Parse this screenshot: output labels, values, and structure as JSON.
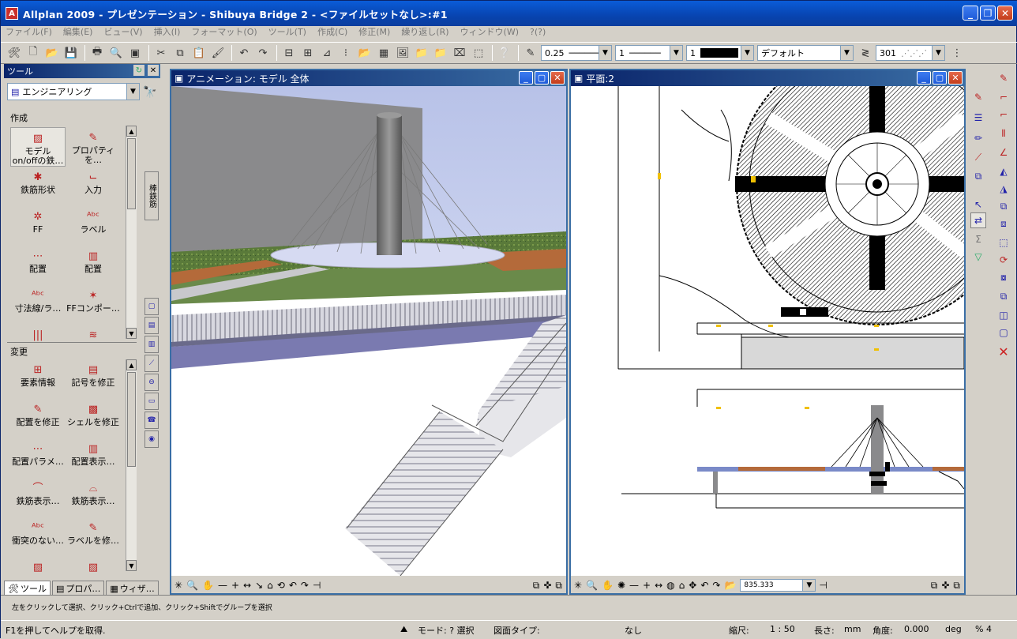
{
  "window": {
    "title": "Allplan 2009 - プレゼンテーション - Shibuya Bridge 2 - <ファイルセットなし>:#1",
    "app_icon": "allplan-icon"
  },
  "menu": [
    "ファイル(F)",
    "編集(E)",
    "ビュー(V)",
    "挿入(I)",
    "フォーマット(O)",
    "ツール(T)",
    "作成(C)",
    "修正(M)",
    "繰り返し(R)",
    "ウィンドウ(W)",
    "?(?)"
  ],
  "toolbar": {
    "pen_thickness": "0.25",
    "line_type": "1",
    "color": "1",
    "layer": "デフォルト",
    "hatch": "301"
  },
  "palette": {
    "title": "ツール",
    "module": "エンジニアリング",
    "side_tab_label": "棒鉄筋",
    "section_create": "作成",
    "section_modify": "変更",
    "create_items": [
      {
        "label": "モデル on/offの鉄…"
      },
      {
        "label": "プロパティを…"
      },
      {
        "label": "鉄筋形状"
      },
      {
        "label": "入力"
      },
      {
        "label": "FF"
      },
      {
        "label": "ラベル"
      },
      {
        "label": "配置"
      },
      {
        "label": "配置"
      },
      {
        "label": "寸法線/ラ…"
      },
      {
        "label": "FFコンポー…"
      },
      {
        "label": ""
      },
      {
        "label": ""
      }
    ],
    "modify_items": [
      {
        "label": "要素情報"
      },
      {
        "label": "記号を修正"
      },
      {
        "label": "配置を修正"
      },
      {
        "label": "シェルを修正"
      },
      {
        "label": "配置パラメ…"
      },
      {
        "label": "配置表示…"
      },
      {
        "label": "鉄筋表示…"
      },
      {
        "label": "鉄筋表示…"
      },
      {
        "label": "衝突のない…"
      },
      {
        "label": "ラベルを修…"
      },
      {
        "label": ""
      },
      {
        "label": ""
      }
    ],
    "tabs": [
      "ツール",
      "プロパ…",
      "ウィザ…"
    ]
  },
  "view_animation": {
    "title": "アニメーション: モデル 全体"
  },
  "view_plan": {
    "title": "平面:2",
    "zoom_value": "835.333"
  },
  "hint": "左をクリックして選択、クリック+Ctrlで追加、クリック+Shiftでグループを選択",
  "status": {
    "help": "F1を押してヘルプを取得.",
    "mode": "モード: ? 選択",
    "drawing_type_label": "図面タイプ:",
    "drawing_type": "なし",
    "scale_label": "縮尺:",
    "scale": "1 : 50",
    "length_label": "長さ:",
    "length": "mm",
    "angle_label": "角度:",
    "angle": "0.000",
    "angle_unit": "deg",
    "percent": "% 4"
  }
}
